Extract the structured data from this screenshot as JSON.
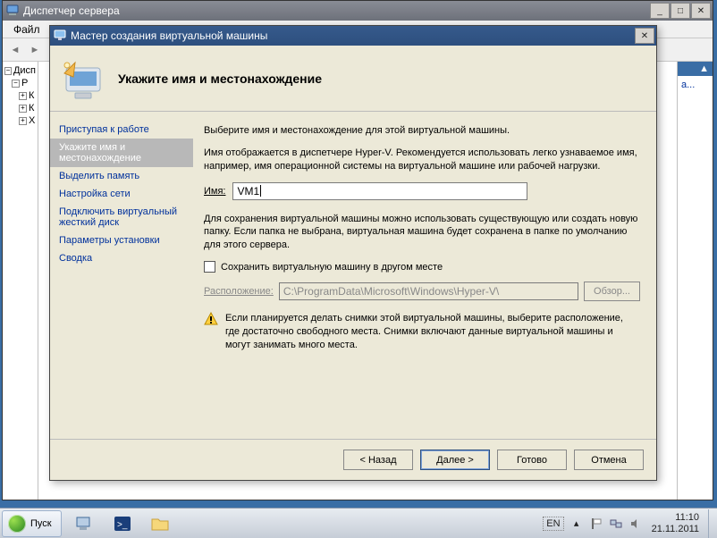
{
  "parent": {
    "title": "Диспетчер сервера",
    "menu": {
      "file": "Файл"
    },
    "tree": {
      "root": "Дисп",
      "r": "Р",
      "k1": "К",
      "k2": "К",
      "x": "Х"
    },
    "actions_right": "а..."
  },
  "wizard": {
    "title": "Мастер создания виртуальной машины",
    "heading": "Укажите имя и местонахождение",
    "nav": {
      "start": "Приступая к работе",
      "name": "Укажите имя и местонахождение",
      "memory": "Выделить память",
      "network": "Настройка сети",
      "vhd": "Подключить виртуальный жесткий диск",
      "options": "Параметры установки",
      "summary": "Сводка"
    },
    "main": {
      "intro": "Выберите имя и местонахождение для этой виртуальной машины.",
      "desc": "Имя отображается в диспетчере Hyper-V. Рекомендуется использовать легко узнаваемое имя, например, имя операционной системы на виртуальной машине или рабочей нагрузки.",
      "name_label": "Имя:",
      "name_value": "VM1",
      "desc2": "Для сохранения виртуальной машины можно использовать существующую или создать новую папку. Если папка не выбрана, виртуальная машина будет сохранена в папке по умолчанию для этого сервера.",
      "chk_label": "Сохранить виртуальную машину в другом месте",
      "loc_label": "Расположение:",
      "loc_value": "C:\\ProgramData\\Microsoft\\Windows\\Hyper-V\\",
      "browse": "Обзор...",
      "warn": "Если планируется делать снимки этой виртуальной машины, выберите расположение, где достаточно свободного места. Снимки включают данные виртуальной машины и могут занимать много места."
    },
    "footer": {
      "back": "< Назад",
      "next": "Далее >",
      "finish": "Готово",
      "cancel": "Отмена"
    }
  },
  "taskbar": {
    "start": "Пуск",
    "lang": "EN",
    "time": "11:10",
    "date": "21.11.2011"
  }
}
